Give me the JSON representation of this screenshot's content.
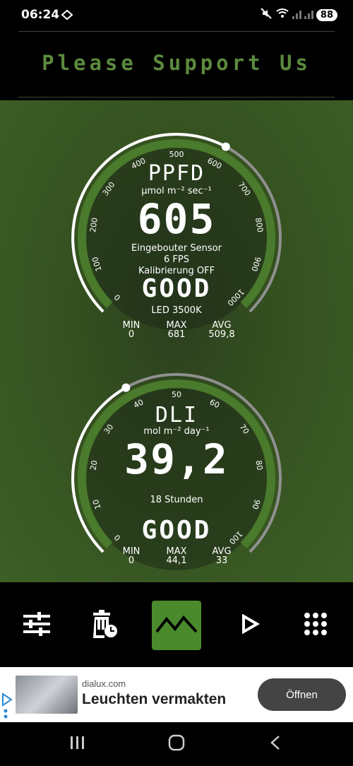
{
  "status": {
    "time": "06:24",
    "battery": "88"
  },
  "header": {
    "title": "Please Support Us"
  },
  "ppfd": {
    "label": "PPFD",
    "unit": "µmol m⁻² sec⁻¹",
    "value": "605",
    "sensor": "Eingebouter Sensor",
    "fps": "6 FPS",
    "calibration": "Kalibrierung OFF",
    "rating": "GOOD",
    "light": "LED 3500K",
    "stats": {
      "min_label": "MIN",
      "min": "0",
      "max_label": "MAX",
      "max": "681",
      "avg_label": "AVG",
      "avg": "509,8"
    },
    "ticks": [
      "0",
      "100",
      "200",
      "300",
      "400",
      "500",
      "600",
      "700",
      "800",
      "900",
      "1000"
    ],
    "level": 0.605
  },
  "dli": {
    "label": "DLI",
    "unit": "mol m⁻² day⁻¹",
    "value": "39,2",
    "hours": "18 Stunden",
    "rating": "GOOD",
    "stats": {
      "min_label": "MIN",
      "min": "0",
      "max_label": "MAX",
      "max": "44,1",
      "avg_label": "AVG",
      "avg": "33"
    },
    "ticks": [
      "0",
      "10",
      "20",
      "30",
      "40",
      "50",
      "60",
      "70",
      "80",
      "90",
      "100"
    ],
    "level": 0.392
  },
  "toolbar": {
    "icons": [
      "sliders-icon",
      "history-delete-icon",
      "graph-icon",
      "play-icon",
      "grid-menu-icon"
    ]
  },
  "ad": {
    "domain": "dialux.com",
    "headline": "Leuchten vermakten",
    "button": "Öffnen"
  },
  "colors": {
    "accent": "#5b8a3e",
    "active": "#4a8a2c",
    "ring": "#4a7a2c"
  }
}
